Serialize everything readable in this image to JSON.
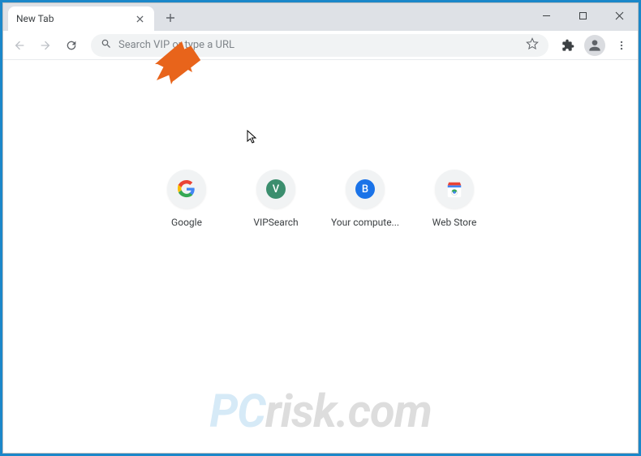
{
  "window": {
    "tab_title": "New Tab"
  },
  "toolbar": {
    "omnibox_placeholder": "Search VIP or type a URL"
  },
  "shortcuts": [
    {
      "label": "Google",
      "kind": "google"
    },
    {
      "label": "VIPSearch",
      "kind": "letter",
      "letter": "V",
      "bg": "#3b8e6e"
    },
    {
      "label": "Your compute...",
      "kind": "letter",
      "letter": "B",
      "bg": "#1a73e8"
    },
    {
      "label": "Web Store",
      "kind": "webstore"
    }
  ],
  "watermark": {
    "pc": "PC",
    "rest": "risk.com"
  }
}
